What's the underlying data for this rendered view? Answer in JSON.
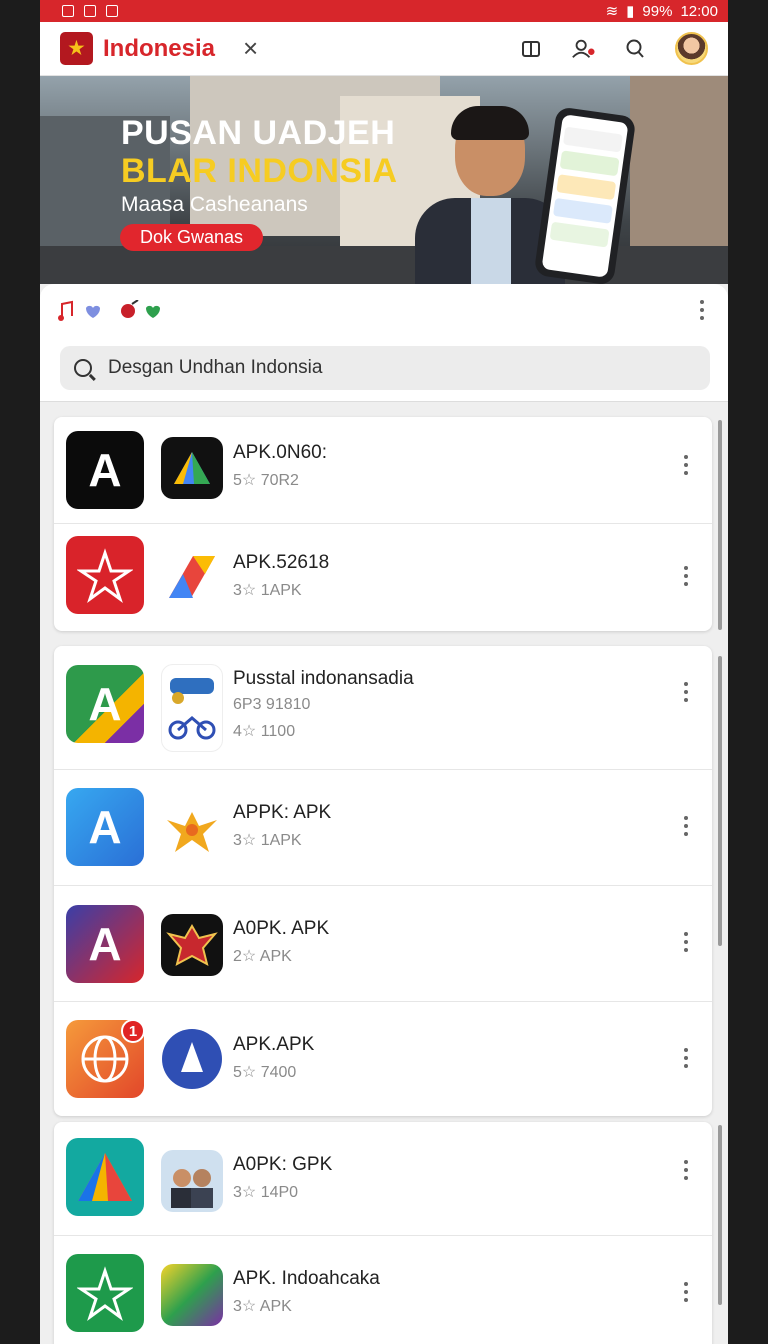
{
  "status": {
    "icons_left": [
      "sim-icon",
      "message-icon",
      "mail-icon"
    ],
    "battery": "99%",
    "time": "12:00"
  },
  "appbar": {
    "title": "Indonesia",
    "close_label": "×"
  },
  "banner": {
    "title_line1": "PUSAN UADJEH",
    "title_line2": "BLAR INDONSIA",
    "subtitle": "Maasa Casheanans",
    "button": "Dok Gwanas"
  },
  "chips": [
    "music-heart-icon",
    "pin-heart-icon"
  ],
  "search": {
    "value": "Desgan Undhan Indonsia"
  },
  "cards": [
    {
      "rows": [
        {
          "title": "APK.0N60:",
          "sub": "5☆ 70R2",
          "sub2": "",
          "icon1_color": "#0b0b0b",
          "icon2_color": "#111"
        },
        {
          "title": "APK.52618",
          "sub": "3☆ 1APK",
          "sub2": "",
          "icon1_color": "#d9232a",
          "icon2_color": "#fff"
        }
      ]
    },
    {
      "rows": [
        {
          "title": "Pusstal indonansadia",
          "sub": "6P3 91810",
          "sub2": "4☆ 1100",
          "icon1_color": "#2e9a4b",
          "icon2_color": "#fff"
        },
        {
          "title": "APPK: APK",
          "sub": "3☆ 1APK",
          "sub2": "",
          "icon1_color": "#2f8be0",
          "icon2_color": "#fff"
        },
        {
          "title": "A0PK. APK",
          "sub": "2☆ APK",
          "sub2": "",
          "icon1_color": "#3a3fa8",
          "icon2_color": "#111"
        },
        {
          "title": "APK.APK",
          "sub": "5☆ 7400",
          "sub2": "",
          "icon1_color": "#f0642d",
          "icon2_color": "#2f4fb4",
          "badge": "1"
        }
      ]
    },
    {
      "rows": [
        {
          "title": "A0PK: GPK",
          "sub": "3☆ 14P0",
          "sub2": "",
          "icon1_color": "#13a9a0",
          "icon2_color": "#fff"
        },
        {
          "title": "APK. Indoahcaka",
          "sub": "3☆ APK",
          "sub2": "",
          "icon1_color": "#1e9a4b",
          "icon2_color": "#fff"
        }
      ]
    }
  ]
}
